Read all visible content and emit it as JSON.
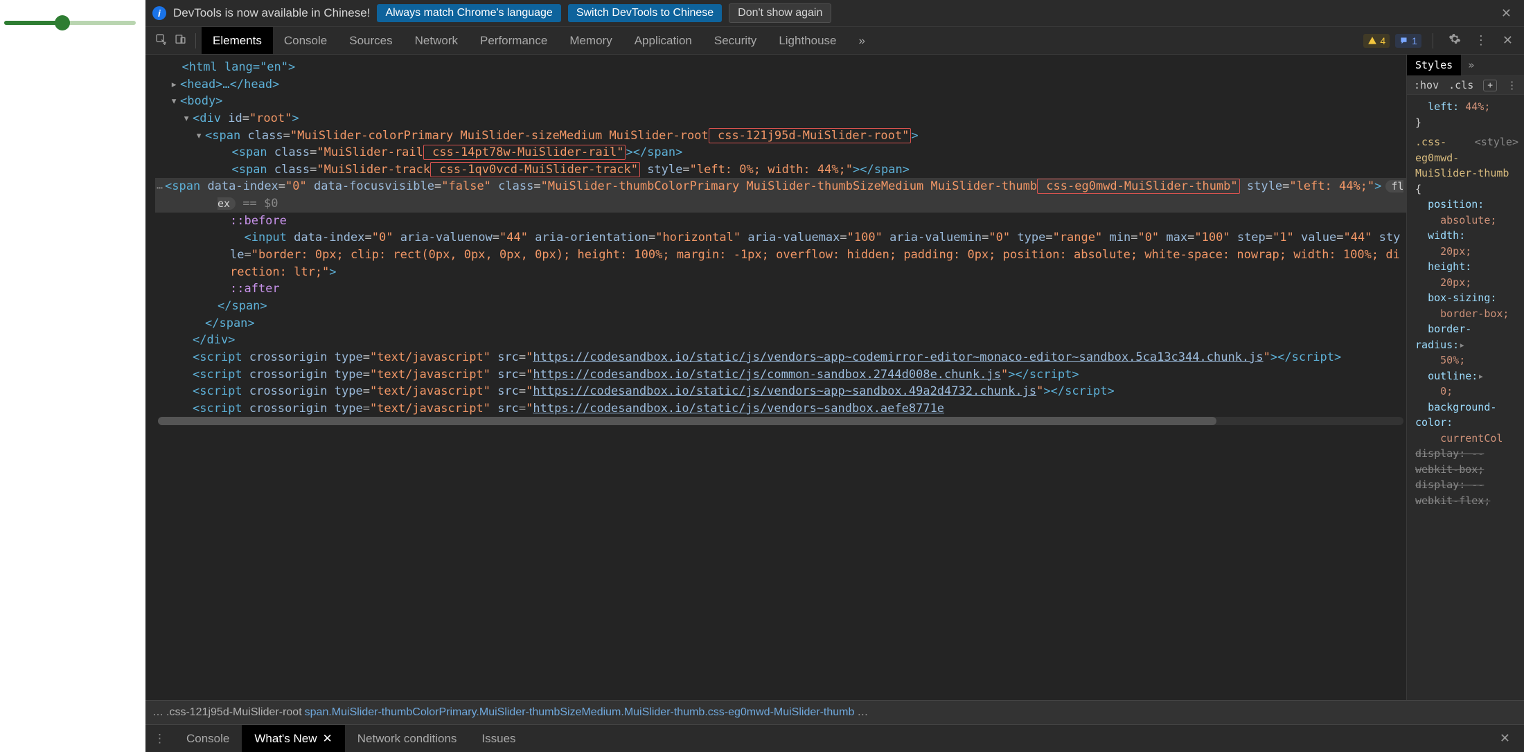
{
  "slider": {
    "percent": 44
  },
  "notification": {
    "text": "DevTools is now available in Chinese!",
    "btn_match": "Always match Chrome's language",
    "btn_switch": "Switch DevTools to Chinese",
    "btn_dismiss": "Don't show again"
  },
  "tabs": {
    "active": "Elements",
    "items": [
      "Elements",
      "Console",
      "Sources",
      "Network",
      "Performance",
      "Memory",
      "Application",
      "Security",
      "Lighthouse"
    ],
    "overflow": "»",
    "warn_count": "4",
    "err_count": "1"
  },
  "dom": {
    "html_open": "<html lang=\"en\">",
    "head": "<head>…</head>",
    "body_open": "<body>",
    "root_open": "<div id=\"root\">",
    "slider_root": {
      "pre": "<span class=\"MuiSlider-colorPrimary MuiSlider-sizeMedium MuiSlider-root",
      "boxed": " css-121j95d-MuiSlider-root\"",
      "post": ">"
    },
    "rail": {
      "pre": "<span class=\"MuiSlider-rail",
      "boxed": " css-14pt78w-MuiSlider-rail\"",
      "post": "></span>"
    },
    "track": {
      "pre": "<span class=\"MuiSlider-track",
      "boxed": " css-1qv0vcd-MuiSlider-track\"",
      "style": " style=\"left: 0%; width: 44%;\"",
      "post": "></span>"
    },
    "thumb": {
      "line1": "<span data-index=\"0\" data-focusvisible=\"false\" class=\"MuiSlider-thumbColorPrimary MuiSlider-thumbSizeMedium MuiSlider-thumb",
      "boxed": " css-eg0mwd-MuiSlider-thumb\"",
      "styleattr": " style=\"left: 44%;\">",
      "flex": "flex",
      "eq": "== $0"
    },
    "before": "::before",
    "input": "<input data-index=\"0\" aria-valuenow=\"44\" aria-orientation=\"horizontal\" aria-valuemax=\"100\" aria-valuemin=\"0\" type=\"range\" min=\"0\" max=\"100\" step=\"1\" value=\"44\" style=\"border: 0px; clip: rect(0px, 0px, 0px, 0px); height: 100%; margin: -1px; overflow: hidden; padding: 0px; position: absolute; white-space: nowrap; width: 100%; direction: ltr;\">",
    "after": "::after",
    "span_close": "</span>",
    "span_close2": "</span>",
    "div_close": "</div>",
    "script1a": "<script crossorigin type=\"text/javascript\" src=\"",
    "script1b": "https://codesandbox.io/static/js/vendors~app~codemirror-editor~monaco-editor~sandbox.5ca13c344.chunk.js",
    "script1c": "\"></",
    "scriptword": "script",
    "script2a": "<script crossorigin type=\"text/javascript\" src=\"",
    "script2b": "https://codesandbox.io/static/js/common-sandbox.2744d008e.chunk.js",
    "script3a": "<script crossorigin type=\"text/javascript\" src=\"",
    "script3b": "https://codesandbox.io/static/js/vendors~app~sandbox.49a2d4732.chunk.js",
    "script4a": "<script crossorigin type=\"text/javascript\" src=\"",
    "script4b": "https://codesandbox.io/static/js/vendors~sandbox.aefe8771e"
  },
  "styles_sidebar": {
    "tab": "Styles",
    "more": "»",
    "hov": ":hov",
    "cls": ".cls",
    "plus": "+",
    "rule_top1": "left:",
    "rule_top1v": "44%;",
    "rule_top_close": "}",
    "selector": ".css-eg0mwd-MuiSlider-thumb",
    "source": "<style>",
    "brace_open": "{",
    "props": [
      {
        "k": "position:",
        "v": "absolute;"
      },
      {
        "k": "width:",
        "v": "20px;"
      },
      {
        "k": "height:",
        "v": "20px;"
      },
      {
        "k": "box-sizing:",
        "v": "border-box;"
      },
      {
        "k": "border-radius:",
        "v": "50%;",
        "tri": true
      },
      {
        "k": "outline:",
        "v": "0;",
        "tri": true
      },
      {
        "k": "background-color:",
        "v": "currentCol"
      }
    ],
    "strikes": [
      {
        "k": "display:",
        "v": "-webkit-box;"
      },
      {
        "k": "display:",
        "v": "-webkit-flex;"
      }
    ]
  },
  "breadcrumb": {
    "ell": "…",
    "a": ".css-121j95d-MuiSlider-root",
    "b": "span.MuiSlider-thumbColorPrimary.MuiSlider-thumbSizeMedium.MuiSlider-thumb.css-eg0mwd-MuiSlider-thumb",
    "ell2": "…"
  },
  "drawer": {
    "tabs": [
      "Console",
      "What's New",
      "Network conditions",
      "Issues"
    ],
    "active": "What's New"
  }
}
